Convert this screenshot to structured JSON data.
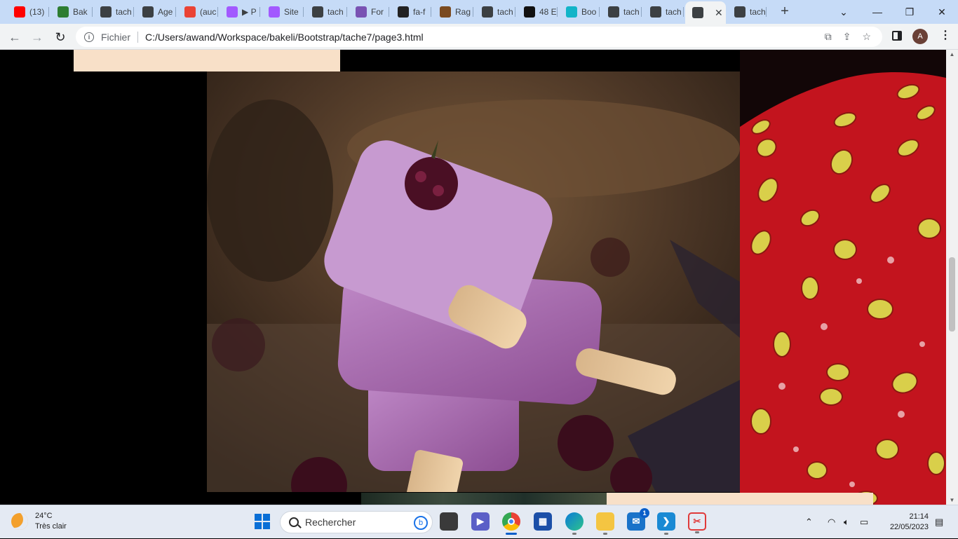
{
  "browser": {
    "tabs": [
      {
        "title": "(13)",
        "favicon": "youtube-icon",
        "color": "#ff0000"
      },
      {
        "title": "Bak",
        "favicon": "bakeli-icon",
        "color": "#2e7d32"
      },
      {
        "title": "tach",
        "favicon": "globe-icon",
        "color": "#3c4043"
      },
      {
        "title": "Age",
        "favicon": "globe-outline-icon",
        "color": "#3c4043"
      },
      {
        "title": "(auc",
        "favicon": "gmail-icon",
        "color": "#ea4335"
      },
      {
        "title": "▶ P",
        "favicon": "figma-icon",
        "color": "#a259ff"
      },
      {
        "title": "Site",
        "favicon": "figma-icon",
        "color": "#a259ff"
      },
      {
        "title": "tach",
        "favicon": "globe-icon",
        "color": "#3c4043"
      },
      {
        "title": "For",
        "favicon": "bootstrap-icon",
        "color": "#7952b3"
      },
      {
        "title": "fa-f",
        "favicon": "flag-icon",
        "color": "#222222"
      },
      {
        "title": "Rag",
        "favicon": "image-icon",
        "color": "#7a4a20"
      },
      {
        "title": "tach",
        "favicon": "globe-icon",
        "color": "#3c4043"
      },
      {
        "title": "48 E",
        "favicon": "f-icon",
        "color": "#111111"
      },
      {
        "title": "Boo",
        "favicon": "bd-icon",
        "color": "#12b4c8"
      },
      {
        "title": "tach",
        "favicon": "globe-icon",
        "color": "#3c4043"
      },
      {
        "title": "tach",
        "favicon": "globe-icon",
        "color": "#3c4043"
      },
      {
        "title": "",
        "favicon": "globe-icon",
        "color": "#3c4043",
        "active": true
      },
      {
        "title": "tach",
        "favicon": "globe-icon",
        "color": "#3c4043"
      }
    ],
    "new_tab": "+",
    "window_controls": {
      "dropdown": "⌄",
      "minimize": "—",
      "maximize": "❐",
      "close": "✕"
    },
    "address": {
      "scheme_label": "Fichier",
      "url": "C:/Users/awand/Workspace/bakeli/Bootstrap/tache7/page3.html"
    },
    "profile_initial": "A"
  },
  "page": {
    "colors": {
      "background": "#000000",
      "peach": "#f8e0c8"
    },
    "images": [
      {
        "name": "blackberry-popsicles-image"
      },
      {
        "name": "strawberry-closeup-image"
      }
    ]
  },
  "taskbar": {
    "weather": {
      "temp": "24°C",
      "condition": "Très clair"
    },
    "search_placeholder": "Rechercher",
    "mail_badge": "1",
    "clock": {
      "time": "21:14",
      "date": "22/05/2023"
    }
  }
}
